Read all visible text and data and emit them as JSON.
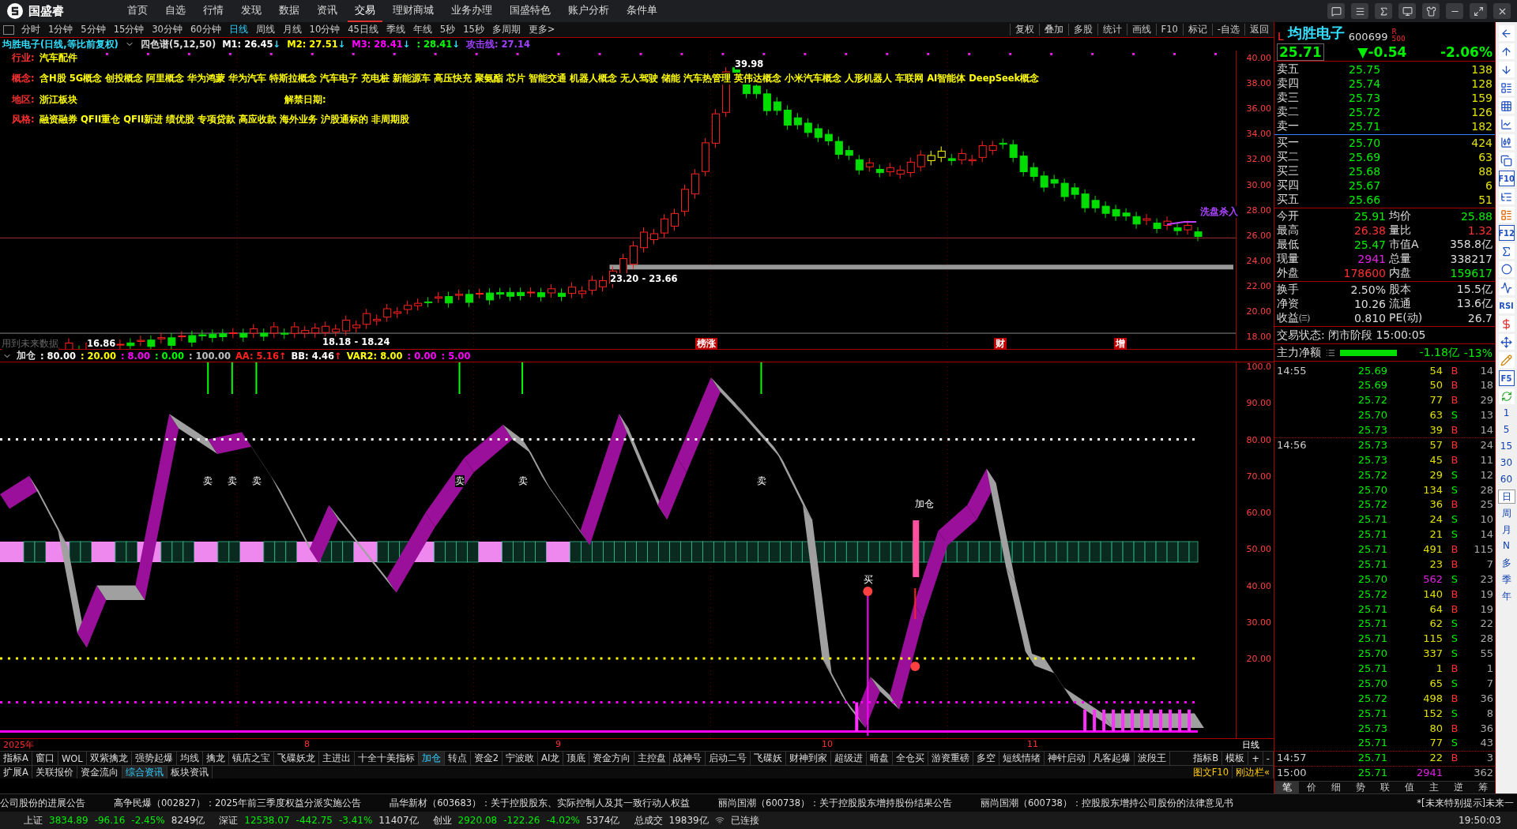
{
  "menu": {
    "brand": "国盛睿",
    "items": [
      {
        "label": "首页",
        "selected": false
      },
      {
        "label": "自选",
        "selected": false
      },
      {
        "label": "行情",
        "selected": false
      },
      {
        "label": "发现",
        "selected": false
      },
      {
        "label": "数据",
        "selected": false
      },
      {
        "label": "资讯",
        "selected": false
      },
      {
        "label": "交易",
        "selected": true
      },
      {
        "label": "理财商城",
        "selected": false
      },
      {
        "label": "业务办理",
        "selected": false
      },
      {
        "label": "国盛特色",
        "selected": false
      },
      {
        "label": "账户分析",
        "selected": false
      },
      {
        "label": "条件单",
        "selected": false
      }
    ]
  },
  "toolbar": {
    "periods": [
      {
        "label": "分时",
        "selected": false
      },
      {
        "label": "1分钟",
        "selected": false
      },
      {
        "label": "5分钟",
        "selected": false
      },
      {
        "label": "15分钟",
        "selected": false
      },
      {
        "label": "30分钟",
        "selected": false
      },
      {
        "label": "60分钟",
        "selected": false
      },
      {
        "label": "日线",
        "selected": true
      },
      {
        "label": "周线",
        "selected": false
      },
      {
        "label": "月线",
        "selected": false
      },
      {
        "label": "10分钟",
        "selected": false
      },
      {
        "label": "45日线",
        "selected": false
      },
      {
        "label": "季线",
        "selected": false
      },
      {
        "label": "年线",
        "selected": false
      },
      {
        "label": "5秒",
        "selected": false
      },
      {
        "label": "15秒",
        "selected": false
      },
      {
        "label": "多周期",
        "selected": false
      },
      {
        "label": "更多>",
        "selected": false
      }
    ],
    "tools": [
      "复权",
      "叠加",
      "多股",
      "统计",
      "画线",
      "F10",
      "标记",
      "-自选",
      "返回"
    ]
  },
  "chart": {
    "title": "均胜电子(日线,等比前复权)",
    "indicator": "四色谱(5,12,50)",
    "mas": [
      {
        "label": "M1: 26.45",
        "color": "#ffffff",
        "arrow": "↓"
      },
      {
        "label": "M2: 27.51",
        "color": "#ffff00",
        "arrow": "↓"
      },
      {
        "label": "M3: 28.41",
        "color": "#ff00ff",
        "arrow": "↓"
      },
      {
        "label": ": 28.41",
        "color": "#00ff00",
        "arrow": "↓"
      },
      {
        "label": "攻击线: 27.14",
        "color": "#a040ff"
      }
    ],
    "info": [
      {
        "label": "行业:",
        "value": "汽车配件"
      },
      {
        "label": "概念:",
        "value": "含H股 5G概念 创投概念 阿里概念 华为鸿蒙 华为汽车 特斯拉概念 汽车电子 充电桩 新能源车 高压快充 聚氨酯 芯片 智能交通 机器人概念 无人驾驶 储能 汽车热管理 英伟达概念 小米汽车概念 人形机器人 车联网 AI智能体 DeepSeek概念"
      },
      {
        "label": "地区:",
        "value": "浙江板块",
        "extra": "解禁日期:"
      },
      {
        "label": "风格:",
        "value": "融资融券 QFII重仓 QFII新进 绩优股 专项贷款 高应收款 海外业务 沪股通标的 非周期股"
      }
    ],
    "y_ticks": [
      "40.00",
      "38.00",
      "36.00",
      "34.00",
      "32.00",
      "30.00",
      "28.00",
      "26.00",
      "24.00",
      "22.00",
      "20.00",
      "18.00"
    ],
    "high": "39.98",
    "zone_high": "23.20 - 23.66",
    "zone_low": "18.18 - 18.24",
    "low": "16.86",
    "signal": "洗盘杀入",
    "note": "用到未来数据",
    "events": [
      "榜涨",
      "财",
      "增"
    ]
  },
  "indicator": {
    "name": "加仓",
    "values": [
      {
        "label": ": 80.00",
        "color": "#ffffff"
      },
      {
        "label": ": 20.00",
        "color": "#ffff00"
      },
      {
        "label": ": 8.00",
        "color": "#ff00ff"
      },
      {
        "label": ": 0.00",
        "color": "#00ff00"
      },
      {
        "label": ": 100.00",
        "color": "#c0c0c0"
      },
      {
        "label": "AA: 5.16",
        "color": "#ff2020",
        "arrow": "↑"
      },
      {
        "label": "BB: 4.46",
        "color": "#ffffff",
        "arrow": "↑"
      },
      {
        "label": "VAR2: 8.00",
        "color": "#ffff00"
      },
      {
        "label": ": 0.00",
        "color": "#ff00ff"
      },
      {
        "label": ": 5.00",
        "color": "#ff00ff"
      }
    ],
    "y_ticks": [
      "100.0",
      "90.00",
      "80.00",
      "70.00",
      "60.00",
      "50.00",
      "40.00",
      "30.00",
      "20.00"
    ],
    "signals": [
      {
        "kind": "sell",
        "label": "卖"
      },
      {
        "kind": "sell",
        "label": "卖"
      },
      {
        "kind": "sell",
        "label": "卖"
      },
      {
        "kind": "sell",
        "label": "卖"
      },
      {
        "kind": "sell",
        "label": "卖"
      },
      {
        "kind": "sell",
        "label": "卖"
      },
      {
        "kind": "buy",
        "label": "买"
      },
      {
        "kind": "add",
        "label": "加仓"
      }
    ]
  },
  "date_axis": {
    "labels": [
      "2025年",
      "8",
      "9",
      "10",
      "11"
    ],
    "period": "日线"
  },
  "tabs": {
    "row1": [
      {
        "label": "指标A",
        "selected": false
      },
      {
        "label": "窗口",
        "selected": false
      },
      {
        "label": "WOL",
        "selected": false
      },
      {
        "label": "双紫擒龙",
        "selected": false
      },
      {
        "label": "强势起爆",
        "selected": false
      },
      {
        "label": "均线",
        "selected": false
      },
      {
        "label": "擒龙",
        "selected": false
      },
      {
        "label": "镇店之宝",
        "selected": false
      },
      {
        "label": "飞碟妖龙",
        "selected": false
      },
      {
        "label": "主进出",
        "selected": false
      },
      {
        "label": "十全十美指标",
        "selected": false
      },
      {
        "label": "加仓",
        "selected": true
      },
      {
        "label": "转点",
        "selected": false
      },
      {
        "label": "资金2",
        "selected": false
      },
      {
        "label": "宁波敢",
        "selected": false
      },
      {
        "label": "AI龙",
        "selected": false
      },
      {
        "label": "顶底",
        "selected": false
      },
      {
        "label": "资金方向",
        "selected": false
      },
      {
        "label": "主控盘",
        "selected": false
      },
      {
        "label": "战神号",
        "selected": false
      },
      {
        "label": "启动二号",
        "selected": false
      },
      {
        "label": "飞碟妖",
        "selected": false
      },
      {
        "label": "财神到家",
        "selected": false
      },
      {
        "label": "超级进",
        "selected": false
      },
      {
        "label": "暗盘",
        "selected": false
      },
      {
        "label": "全仓买",
        "selected": false
      },
      {
        "label": "游资重磅",
        "selected": false
      },
      {
        "label": "多空",
        "selected": false
      },
      {
        "label": "短线情绪",
        "selected": false
      },
      {
        "label": "神针启动",
        "selected": false
      },
      {
        "label": "凡客起爆",
        "selected": false
      },
      {
        "label": "波段王",
        "selected": false
      }
    ],
    "row1_right": [
      "指标B",
      "模板",
      "+",
      "-"
    ],
    "row2": [
      {
        "label": "扩展A",
        "selected": false
      },
      {
        "label": "关联报价",
        "selected": false
      },
      {
        "label": "资金流向",
        "selected": false
      },
      {
        "label": "综合资讯",
        "selected": true
      },
      {
        "label": "板块资讯",
        "selected": false
      }
    ],
    "row2_right": [
      "图文F10",
      "刚边栏«"
    ]
  },
  "quote": {
    "marker": "L",
    "name": "均胜电子",
    "code": "600699",
    "flag": "R",
    "flag_sub": "500",
    "price": "25.71",
    "change": "▼-0.54",
    "pct": "-2.06%",
    "asks": [
      {
        "label": "卖五",
        "price": "25.75",
        "volume": "138"
      },
      {
        "label": "卖四",
        "price": "25.74",
        "volume": "128"
      },
      {
        "label": "卖三",
        "price": "25.73",
        "volume": "159"
      },
      {
        "label": "卖二",
        "price": "25.72",
        "volume": "126"
      },
      {
        "label": "卖一",
        "price": "25.71",
        "volume": "182"
      }
    ],
    "bids": [
      {
        "label": "买一",
        "price": "25.70",
        "volume": "424"
      },
      {
        "label": "买二",
        "price": "25.69",
        "volume": "63"
      },
      {
        "label": "买三",
        "price": "25.68",
        "volume": "88"
      },
      {
        "label": "买四",
        "price": "25.67",
        "volume": "6"
      },
      {
        "label": "买五",
        "price": "25.66",
        "volume": "51"
      }
    ],
    "stats": [
      {
        "cells": [
          {
            "label": "今开",
            "value": "25.91",
            "color": "#00ee00"
          },
          {
            "label": "均价",
            "value": "25.88",
            "color": "#00ee00"
          }
        ]
      },
      {
        "cells": [
          {
            "label": "最高",
            "value": "26.38",
            "color": "#ff3030"
          },
          {
            "label": "量比",
            "value": "1.32",
            "color": "#ff3030"
          }
        ]
      },
      {
        "cells": [
          {
            "label": "最低",
            "value": "25.47",
            "color": "#00ee00"
          },
          {
            "label": "市值A",
            "value": "358.8亿",
            "color": "#dddddd"
          }
        ]
      },
      {
        "cells": [
          {
            "label": "现量",
            "value": "2941",
            "color": "#e020e0"
          },
          {
            "label": "总量",
            "value": "338217",
            "color": "#dddddd"
          }
        ]
      },
      {
        "cells": [
          {
            "label": "外盘",
            "value": "178600",
            "color": "#ff3030"
          },
          {
            "label": "内盘",
            "value": "159617",
            "color": "#00ee00"
          }
        ]
      }
    ],
    "stats2": [
      {
        "cells": [
          {
            "label": "换手",
            "value": "2.50%"
          },
          {
            "label": "股本",
            "value": "15.5亿"
          }
        ]
      },
      {
        "cells": [
          {
            "label": "净资",
            "value": "10.26"
          },
          {
            "label": "流通",
            "value": "13.6亿"
          }
        ]
      },
      {
        "cells": [
          {
            "label": "收益㈢",
            "value": "0.810"
          },
          {
            "label": "PE(动)",
            "value": "26.7"
          }
        ]
      }
    ],
    "trade_status": "交易状态: 闭市阶段 15:00:05",
    "main_flow": {
      "label": "主力净额",
      "value": "-1.18亿",
      "pct": "-13%"
    },
    "ticks": [
      {
        "time": "14:55",
        "price": "25.69",
        "volume": "54",
        "side": "B",
        "count": "14",
        "big": false
      },
      {
        "price": "25.69",
        "volume": "50",
        "side": "B",
        "count": "18",
        "big": false
      },
      {
        "price": "25.72",
        "volume": "77",
        "side": "B",
        "count": "29",
        "big": false
      },
      {
        "price": "25.70",
        "volume": "63",
        "side": "S",
        "count": "13",
        "big": false
      },
      {
        "price": "25.73",
        "volume": "39",
        "side": "B",
        "count": "14",
        "big": false
      },
      {
        "time": "14:56",
        "price": "25.73",
        "volume": "57",
        "side": "B",
        "count": "24",
        "big": false
      },
      {
        "price": "25.73",
        "volume": "45",
        "side": "B",
        "count": "11",
        "big": false
      },
      {
        "price": "25.72",
        "volume": "29",
        "side": "S",
        "count": "12",
        "big": false
      },
      {
        "price": "25.70",
        "volume": "134",
        "side": "S",
        "count": "28",
        "big": false
      },
      {
        "price": "25.72",
        "volume": "36",
        "side": "B",
        "count": "25",
        "big": false
      },
      {
        "price": "25.71",
        "volume": "24",
        "side": "S",
        "count": "10",
        "big": false
      },
      {
        "price": "25.71",
        "volume": "21",
        "side": "S",
        "count": "14",
        "big": false
      },
      {
        "price": "25.71",
        "volume": "491",
        "side": "B",
        "count": "115",
        "big": false
      },
      {
        "price": "25.71",
        "volume": "23",
        "side": "B",
        "count": "7",
        "big": false
      },
      {
        "price": "25.70",
        "volume": "562",
        "side": "S",
        "count": "23",
        "big": true
      },
      {
        "price": "25.72",
        "volume": "140",
        "side": "B",
        "count": "19",
        "big": false
      },
      {
        "price": "25.71",
        "volume": "64",
        "side": "B",
        "count": "19",
        "big": false
      },
      {
        "price": "25.71",
        "volume": "62",
        "side": "S",
        "count": "22",
        "big": false
      },
      {
        "price": "25.71",
        "volume": "115",
        "side": "S",
        "count": "28",
        "big": false
      },
      {
        "price": "25.70",
        "volume": "337",
        "side": "S",
        "count": "55",
        "big": false
      },
      {
        "price": "25.71",
        "volume": "1",
        "side": "B",
        "count": "1",
        "big": false
      },
      {
        "price": "25.70",
        "volume": "65",
        "side": "S",
        "count": "7",
        "big": false
      },
      {
        "price": "25.72",
        "volume": "498",
        "side": "B",
        "count": "36",
        "big": false
      },
      {
        "price": "25.71",
        "volume": "152",
        "side": "S",
        "count": "8",
        "big": false
      },
      {
        "price": "25.73",
        "volume": "80",
        "side": "B",
        "count": "36",
        "big": false
      },
      {
        "price": "25.71",
        "volume": "77",
        "side": "S",
        "count": "43",
        "big": false
      },
      {
        "time": "14:57",
        "price": "25.71",
        "volume": "22",
        "side": "B",
        "count": "3",
        "big": false
      },
      {
        "time": "15:00",
        "price": "25.71",
        "volume": "2941",
        "count": "362",
        "big": true
      }
    ],
    "tabs": [
      {
        "label": "笔",
        "selected": true
      },
      {
        "label": "价",
        "selected": false
      },
      {
        "label": "细",
        "selected": false
      },
      {
        "label": "势",
        "selected": false
      },
      {
        "label": "联",
        "selected": false
      },
      {
        "label": "值",
        "selected": false
      },
      {
        "label": "主",
        "selected": false
      },
      {
        "label": "逆",
        "selected": false
      },
      {
        "label": "筹",
        "selected": false
      }
    ]
  },
  "side_strip": {
    "codes": [
      "F10",
      "F12",
      "F5"
    ],
    "periods": [
      {
        "label": "1",
        "selected": false
      },
      {
        "label": "5",
        "selected": false
      },
      {
        "label": "15",
        "selected": false
      },
      {
        "label": "30",
        "selected": false
      },
      {
        "label": "60",
        "selected": false
      },
      {
        "label": "日",
        "selected": true
      },
      {
        "label": "周",
        "selected": false
      },
      {
        "label": "月",
        "selected": false
      },
      {
        "label": "N",
        "selected": false
      },
      {
        "label": "多",
        "selected": false
      },
      {
        "label": "季",
        "selected": false
      },
      {
        "label": "年",
        "selected": false
      }
    ],
    "rsi": "RSI"
  },
  "news": [
    "公司股份的进展公告",
    "高争民爆（002827）：2025年前三季度权益分派实施公告",
    "晶华新材（603683）：关于控股股东、实际控制人及其一致行动人权益",
    "丽尚国潮（600738）：关于控股股东增持股份结果公告",
    "丽尚国潮（600738）：控股股东增持公司股份的法律意见书"
  ],
  "news_alert": "*[未来特别提示]未来一",
  "status": {
    "indices": [
      {
        "name": "上证",
        "value": "3834.89",
        "change": "-96.16",
        "pct": "-2.45%",
        "amount": "8249亿"
      },
      {
        "name": "深证",
        "value": "12538.07",
        "change": "-442.75",
        "pct": "-3.41%",
        "amount": "11407亿"
      },
      {
        "name": "创业",
        "value": "2920.08",
        "change": "-122.26",
        "pct": "-4.02%",
        "amount": "5374亿"
      }
    ],
    "total_label": "总成交",
    "total": "19839亿",
    "connection": "已连接",
    "time": "19:50:03"
  }
}
